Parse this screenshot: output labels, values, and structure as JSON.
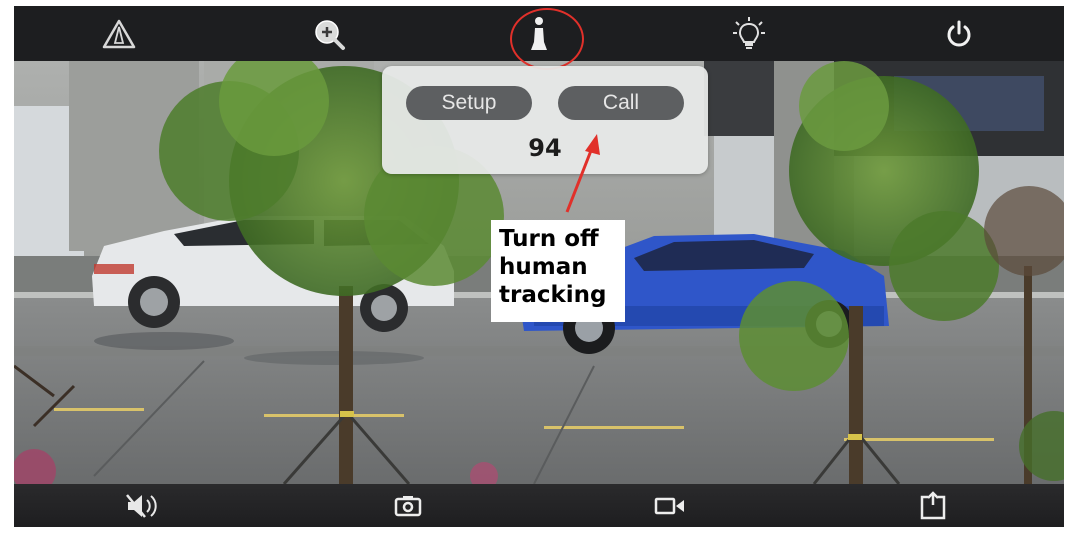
{
  "top_toolbar": {
    "items": [
      {
        "icon": "warning-icon"
      },
      {
        "icon": "zoom-icon"
      },
      {
        "icon": "human-tracking-icon"
      },
      {
        "icon": "light-bulb-icon"
      },
      {
        "icon": "power-icon"
      }
    ]
  },
  "popup": {
    "setup_label": "Setup",
    "call_label": "Call",
    "value": "94"
  },
  "annotation": {
    "lines": [
      "Turn off",
      "human",
      "tracking"
    ],
    "highlight_color": "#e1302a"
  },
  "bottom_toolbar": {
    "items": [
      {
        "icon": "speaker-mute-icon"
      },
      {
        "icon": "snapshot-camera-icon"
      },
      {
        "icon": "record-video-icon"
      },
      {
        "icon": "share-icon"
      }
    ]
  }
}
